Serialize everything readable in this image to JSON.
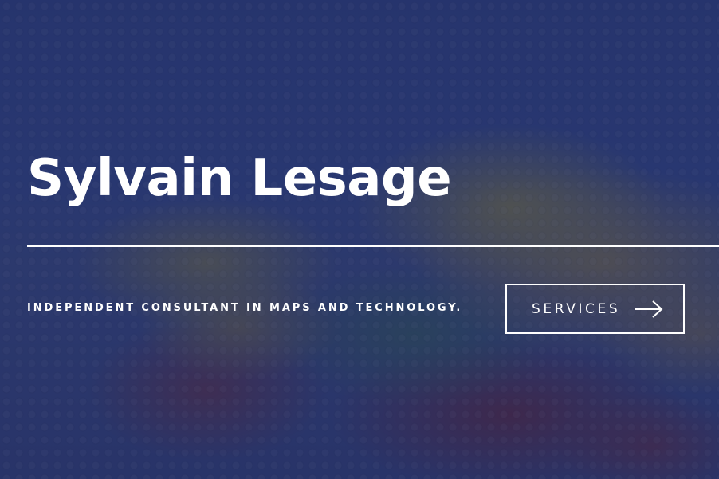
{
  "hero": {
    "title": "Sylvain Lesage",
    "tagline": "INDEPENDENT CONSULTANT IN MAPS AND TECHNOLOGY.",
    "services_button": {
      "label": "SERVICES",
      "icon": "arrow-right-icon"
    }
  },
  "colors": {
    "overlay": "#21295c",
    "text": "#ffffff"
  }
}
